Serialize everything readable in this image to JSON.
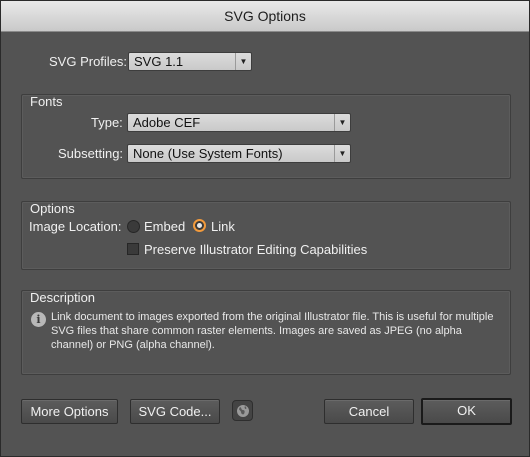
{
  "window": {
    "title": "SVG Options"
  },
  "svg_profiles": {
    "label": "SVG Profiles:",
    "value": "SVG 1.1"
  },
  "fonts": {
    "group_title": "Fonts",
    "type_label": "Type:",
    "type_value": "Adobe CEF",
    "subsetting_label": "Subsetting:",
    "subsetting_value": "None (Use System Fonts)"
  },
  "options": {
    "group_title": "Options",
    "image_location_label": "Image Location:",
    "embed_label": "Embed",
    "link_label": "Link",
    "selected": "Link",
    "preserve_label": "Preserve Illustrator Editing Capabilities",
    "preserve_checked": false
  },
  "description": {
    "group_title": "Description",
    "text": "Link document to images exported from the original Illustrator file. This is useful for multiple SVG files that share common raster elements. Images are saved as JPEG (no alpha channel) or PNG (alpha channel)."
  },
  "buttons": {
    "more_options": "More Options",
    "svg_code": "SVG Code...",
    "cancel": "Cancel",
    "ok": "OK"
  },
  "colors": {
    "accent": "#f29a3c",
    "background": "#535353"
  }
}
